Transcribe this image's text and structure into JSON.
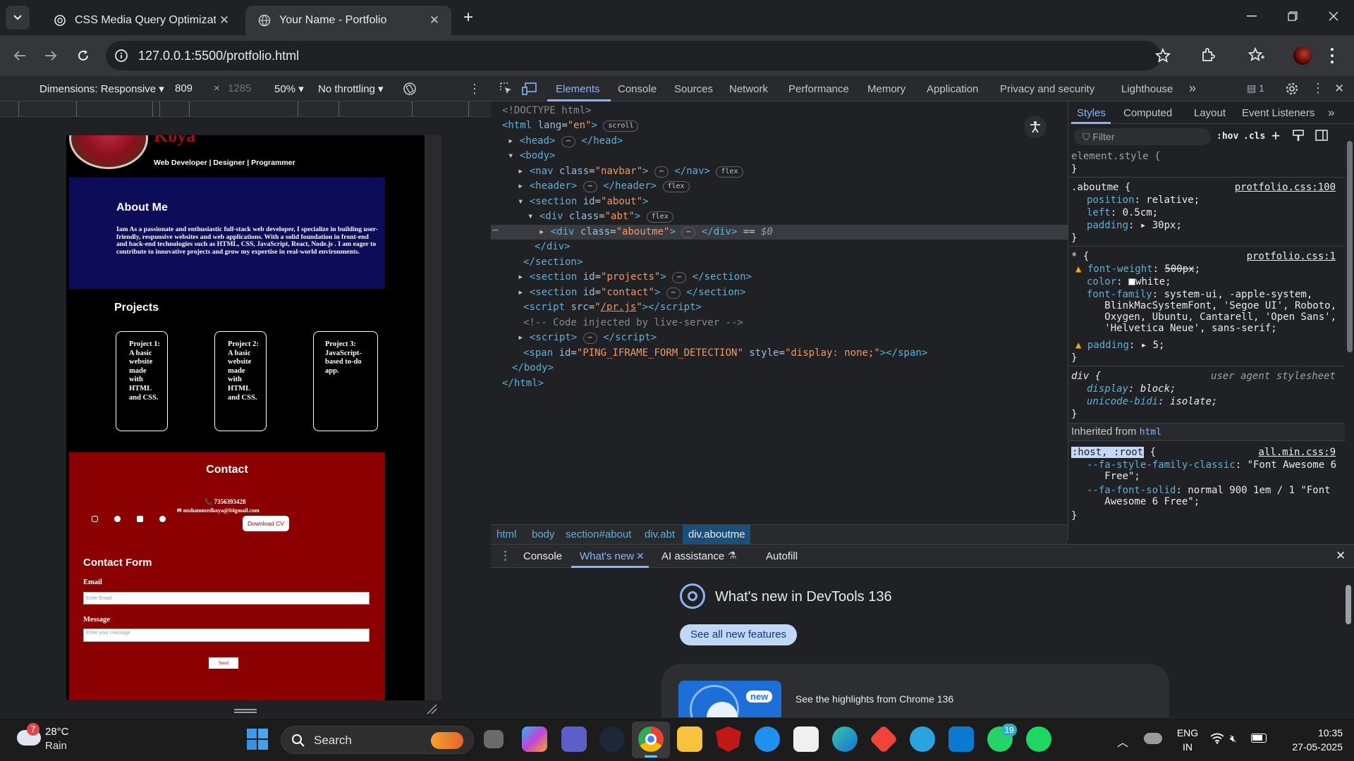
{
  "tabs": [
    {
      "title": "CSS Media Query Optimization",
      "icon": "chatgpt-icon"
    },
    {
      "title": "Your Name - Portfolio",
      "icon": "globe-icon"
    }
  ],
  "address": {
    "url": "127.0.0.1:5500/protfolio.html"
  },
  "device_toolbar": {
    "dimensions": "Dimensions: Responsive",
    "width": "809",
    "times": "×",
    "height": "1285",
    "zoom": "50%",
    "throttling": "No throttling"
  },
  "site": {
    "name_partial": "Koya",
    "tagline": "Web Developer | Designer | Programmer",
    "about_title": "About Me",
    "about_text": "Iam As a passionate and enthusiastic full-stack web developer, I specialize in building user-friendly, responsive websites and web applications. With a solid foundation in front-end and back-end technologies such as HTML, CSS, JavaScript, React, Node.js . I am eager to contribute to innovative projects and grow my expertise in real-world environments.",
    "projects_title": "Projects",
    "projects": [
      "Project 1: A basic website made with HTML and CSS.",
      "Project 2: A basic website made with HTML and CSS.",
      "Project 3: JavaScript-based to-do app."
    ],
    "contact_title": "Contact",
    "phone": "7356393428",
    "email": "muhammedkoya@04gmail.com",
    "download_cv": "Download CV",
    "form_title": "Contact Form",
    "email_label": "Email",
    "email_placeholder": "Enter Email",
    "message_label": "Message",
    "message_placeholder": "Enter your message",
    "send": "Send"
  },
  "devtools": {
    "tabs": [
      "Elements",
      "Console",
      "Sources",
      "Network",
      "Performance",
      "Memory",
      "Application",
      "Privacy and security",
      "Lighthouse"
    ],
    "issues_count": "1",
    "styles_tabs": [
      "Styles",
      "Computed",
      "Layout",
      "Event Listeners"
    ],
    "filter_placeholder": "Filter",
    "hov": ":hov",
    "cls": ".cls",
    "breadcrumbs": [
      "html",
      "body",
      "section#about",
      "div.abt",
      "div.aboutme"
    ],
    "drawer_tabs": [
      "Console",
      "What's new",
      "AI assistance",
      "Autofill"
    ],
    "whats_new_title": "What's new in DevTools 136",
    "see_all": "See all new features",
    "highlight_badge": "new",
    "highlight_text": "See the highlights from Chrome 136",
    "inherited_label": "Inherited from",
    "inherited_from": "html",
    "rules": {
      "element_style": "element.style {",
      "aboutme_selector": ".aboutme {",
      "aboutme_src": "protfolio.css:100",
      "universal_src": "protfolio.css:1",
      "div_src": "user agent stylesheet",
      "root_selector": ":host, :root",
      "root_src": "all.min.css:9"
    }
  },
  "taskbar": {
    "temp": "28°C",
    "weather": "Rain",
    "weather_badge": "7",
    "search": "Search",
    "whatsapp_badge": "19",
    "lang1": "ENG",
    "lang2": "IN",
    "time": "10:35",
    "date": "27-05-2025"
  }
}
